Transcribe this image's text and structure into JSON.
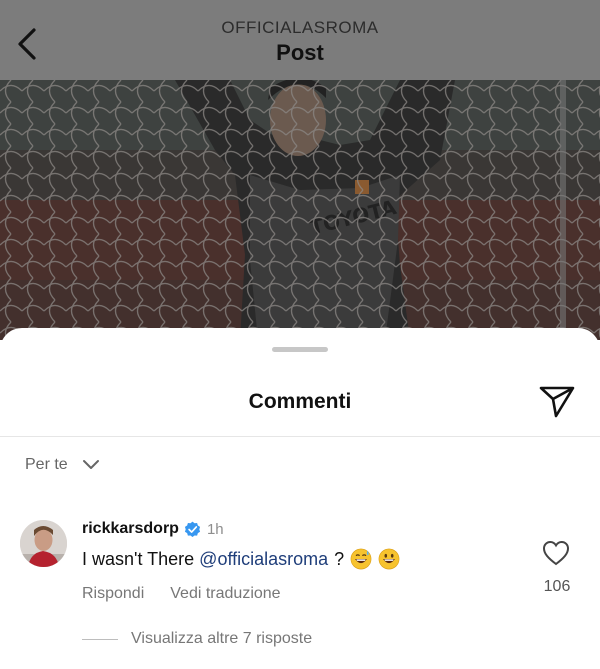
{
  "header": {
    "account": "OFFICIALASROMA",
    "title": "Post"
  },
  "icons": {
    "back": "chevron-left-icon",
    "share": "send-icon",
    "sort": "chevron-down-icon",
    "verified": "verified-badge-icon",
    "like": "heart-icon"
  },
  "sheet": {
    "title": "Commenti",
    "sort_label": "Per te"
  },
  "comment": {
    "username": "rickkarsdorp",
    "time": "1h",
    "text_start": "I wasn't There",
    "mention": "@officialasroma",
    "text_end": "?",
    "reply_label": "Rispondi",
    "translate_label": "Vedi traduzione",
    "like_count": "106",
    "more_replies_label": "Visualizza altre 7 risposte"
  },
  "colors": {
    "verified": "#3797f0",
    "mention": "#1f3e7a",
    "overlay": "#7c7c7c"
  }
}
